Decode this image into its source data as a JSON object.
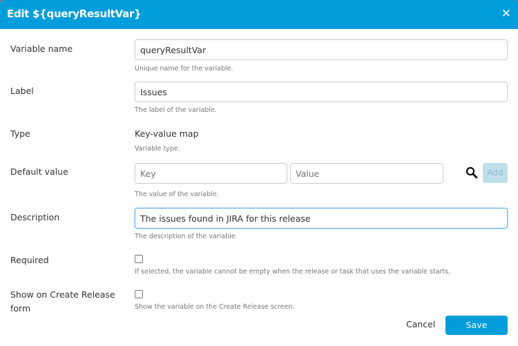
{
  "dialog": {
    "title": "Edit ${queryResultVar}",
    "close_icon": "close-icon"
  },
  "fields": {
    "variable_name": {
      "label": "Variable name",
      "value": "queryResultVar",
      "hint": "Unique name for the variable."
    },
    "label": {
      "label": "Label",
      "value": "Issues",
      "hint": "The label of the variable."
    },
    "type": {
      "label": "Type",
      "value": "Key-value map",
      "hint": "Variable type."
    },
    "default_value": {
      "label": "Default value",
      "key_placeholder": "Key",
      "value_placeholder": "Value",
      "add_label": "Add",
      "hint": "The value of the variable.",
      "search_icon": "search-icon"
    },
    "description": {
      "label": "Description",
      "value": "The issues found in JIRA for this release",
      "hint": "The description of the variable."
    },
    "required": {
      "label": "Required",
      "checked": false,
      "hint": "If selected, the variable cannot be empty when the release or task that uses the variable starts."
    },
    "show_on_create": {
      "label_line1": "Show on Create Release",
      "label_line2": "form",
      "checked": false,
      "hint": "Show the variable on the Create Release screen."
    }
  },
  "footer": {
    "cancel_label": "Cancel",
    "save_label": "Save"
  },
  "colors": {
    "accent": "#009ddc"
  }
}
